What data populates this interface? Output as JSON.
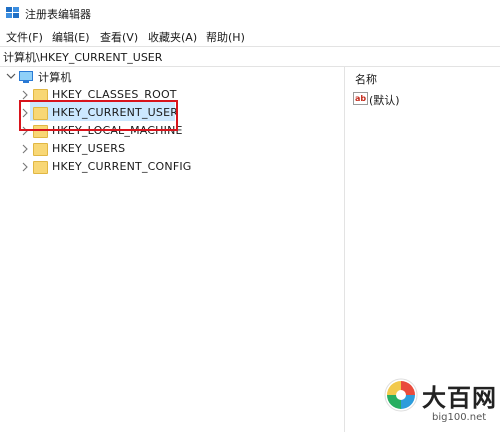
{
  "window": {
    "title": "注册表编辑器"
  },
  "menu": [
    "文件(F)",
    "编辑(E)",
    "查看(V)",
    "收藏夹(A)",
    "帮助(H)"
  ],
  "address_bar": {
    "path": "计算机\\HKEY_CURRENT_USER"
  },
  "tree": {
    "root_label": "计算机",
    "selected": "HKEY_CURRENT_USER",
    "items": [
      {
        "label": "HKEY_CLASSES_ROOT",
        "icon": "folder-icon"
      },
      {
        "label": "HKEY_CURRENT_USER",
        "icon": "folder-icon"
      },
      {
        "label": "HKEY_LOCAL_MACHINE",
        "icon": "folder-icon"
      },
      {
        "label": "HKEY_USERS",
        "icon": "folder-icon"
      },
      {
        "label": "HKEY_CURRENT_CONFIG",
        "icon": "folder-icon"
      }
    ]
  },
  "values_pane": {
    "column_header": "名称",
    "entries": [
      {
        "name": "(默认)",
        "icon": "string-value-icon"
      }
    ]
  },
  "watermark": {
    "brand": "大百网",
    "url": "big100.net"
  },
  "colors": {
    "selection": "#cce8ff",
    "highlight_box": "#d8141c",
    "folder": "#f8d775"
  }
}
